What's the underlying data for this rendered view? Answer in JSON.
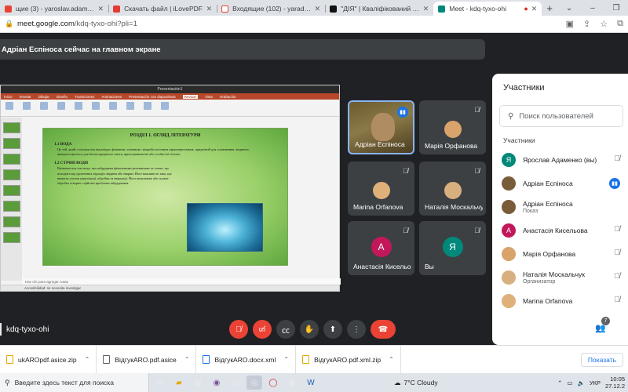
{
  "browser": {
    "tabs": [
      {
        "title": "щие (3) - yaroslav.adamen",
        "color": "#ea4335"
      },
      {
        "title": "Скачать файл | iLovePDF",
        "color": "#e53935"
      },
      {
        "title": "Входящие (102) - yarad1964@g",
        "color": "#ffffff"
      },
      {
        "title": "\"ДІЯ\" | Кваліфікований електро",
        "color": "#111111"
      },
      {
        "title": "Meet - kdq-tyxo-ohi",
        "color": "#00897b"
      }
    ],
    "url_host": "meet.google.com",
    "url_path": "/kdq-tyxo-ohi?pli=1"
  },
  "presenter_banner": "Адріан Еспіноса сейчас на главном экране",
  "shared_screen": {
    "app_title": "Presentación1",
    "ribbon_tabs": [
      "Inicio",
      "Insertar",
      "Dibujar",
      "Diseño",
      "Transiciones",
      "Animaciones",
      "Presentación con diapositivas",
      "Revisar",
      "Vista",
      "Grabación"
    ],
    "active_tab": "Revisar",
    "slide": {
      "title": "РОЗДІЛ 1. ОГЛЯД ЛІТЕРАТУРИ",
      "section1_head": "1.1 ВОДА",
      "section1_body": "Це той, який, оскільки він відповідає фізичним, хімічним і мікробіологічним характеристикам, придатний для споживання людиною, використовується для безпосереднього пиття, приготування їжі або особистої гігієни.",
      "section2_head": "1.2 СТІЧНІ ВОДИ",
      "section2_body": "Визначається тип води, яка забруднена фекальними речовинами та сечею, що походить від органічних відходів людини або тварин. Його важливість така, що вимагає систем каналізації, обробки та евакуації. Його неналежне або погане обробка створює серйозні проблеми забруднення."
    },
    "notes_placeholder": "Haz clic para agregar notas",
    "status": "Accesibilidad: se necesita investigar"
  },
  "tiles": [
    {
      "name": "Адріан Еспіноса",
      "type": "video",
      "speaking": true
    },
    {
      "name": "Марія Орфанова",
      "type": "photo",
      "avatar_color": "#d9a36b"
    },
    {
      "name": "Marina Orfanova",
      "type": "photo",
      "avatar_color": "#e0b07a"
    },
    {
      "name": "Наталія Москальчук",
      "type": "photo",
      "avatar_color": "#d8b080"
    },
    {
      "name": "Анастасія Кисельова",
      "type": "letter",
      "letter": "А",
      "avatar_color": "#c2185b"
    },
    {
      "name": "Вы",
      "type": "letter",
      "letter": "Я",
      "avatar_color": "#00897b"
    }
  ],
  "panel": {
    "title": "Участники",
    "search_placeholder": "Поиск пользователей",
    "section_label": "Участники",
    "participants": [
      {
        "name": "Ярослав Адаменко (вы)",
        "sub": "",
        "letter": "Я",
        "color": "#00897b",
        "mic": "muted"
      },
      {
        "name": "Адріан Еспіноса",
        "sub": "",
        "letter": "",
        "color": "#7a5c3a",
        "mic": "speaking"
      },
      {
        "name": "Адріан Еспіноса",
        "sub": "Показ",
        "letter": "",
        "color": "#7a5c3a",
        "mic": "none"
      },
      {
        "name": "Анастасія Кисельова",
        "sub": "",
        "letter": "А",
        "color": "#c2185b",
        "mic": "muted"
      },
      {
        "name": "Марія Орфанова",
        "sub": "",
        "letter": "",
        "color": "#d9a36b",
        "mic": "muted"
      },
      {
        "name": "Наталія Москальчук",
        "sub": "Организатор",
        "letter": "",
        "color": "#d8b080",
        "mic": "muted"
      },
      {
        "name": "Marina Orfanova",
        "sub": "",
        "letter": "",
        "color": "#e0b07a",
        "mic": "muted"
      }
    ]
  },
  "controls": {
    "meeting_code": "kdq-tyxo-ohi",
    "people_count": "7"
  },
  "downloads": [
    {
      "file": "ukAROpdf.asice.zip",
      "color": "#e6a700"
    },
    {
      "file": "ВідгукARO.pdf.asice",
      "color": "#5f6368"
    },
    {
      "file": "ВідгукARO.docx.xml",
      "color": "#1a73e8"
    },
    {
      "file": "ВідгукARO.pdf.xml.zip",
      "color": "#e6a700"
    }
  ],
  "downloads_show_all": "Показать",
  "taskbar": {
    "search_text": "Введите здесь текст для поиска",
    "weather": "7°C  Cloudy",
    "lang": "УКР",
    "time": "10:05",
    "date": "27.12.2"
  }
}
